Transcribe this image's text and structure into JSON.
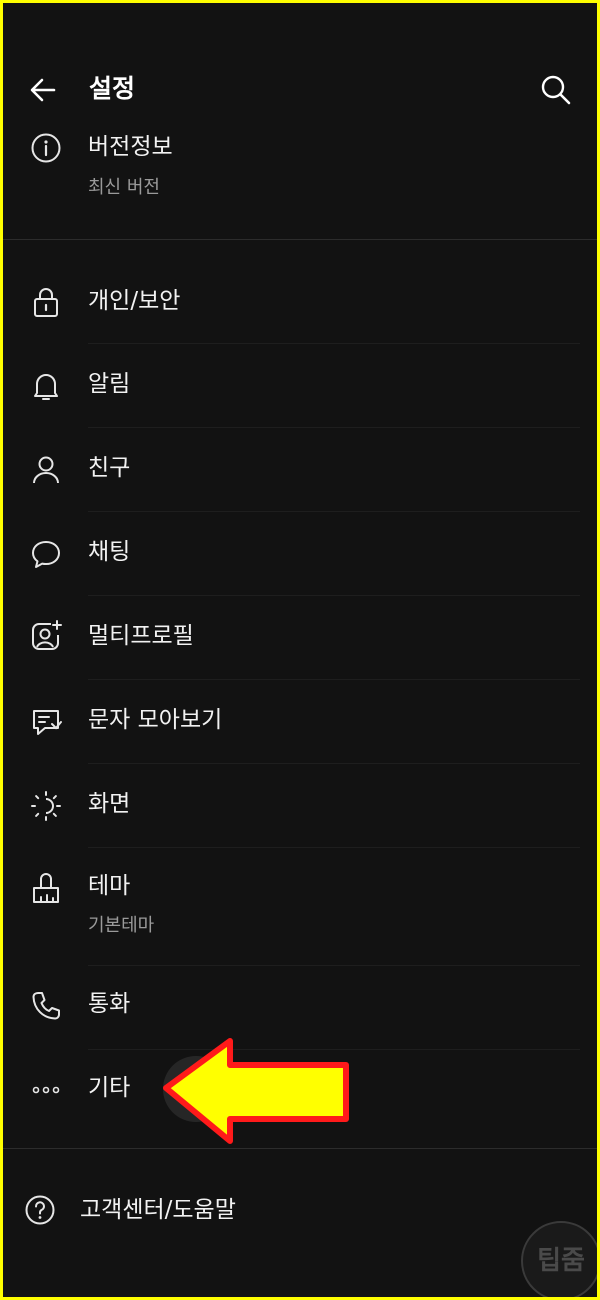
{
  "header": {
    "title": "설정"
  },
  "version": {
    "label": "버전정보",
    "sub": "최신 버전"
  },
  "menu": [
    {
      "label": "개인/보안"
    },
    {
      "label": "알림"
    },
    {
      "label": "친구"
    },
    {
      "label": "채팅"
    },
    {
      "label": "멀티프로필"
    },
    {
      "label": "문자 모아보기"
    },
    {
      "label": "화면"
    },
    {
      "label": "테마",
      "sub": "기본테마"
    },
    {
      "label": "통화"
    },
    {
      "label": "기타"
    }
  ],
  "help": {
    "label": "고객센터/도움말"
  },
  "watermark": {
    "text": "팁줌"
  },
  "colors": {
    "background": "#121212",
    "frame": "#ffff00",
    "arrow_fill": "#ffff00",
    "arrow_stroke": "#ff0000"
  }
}
